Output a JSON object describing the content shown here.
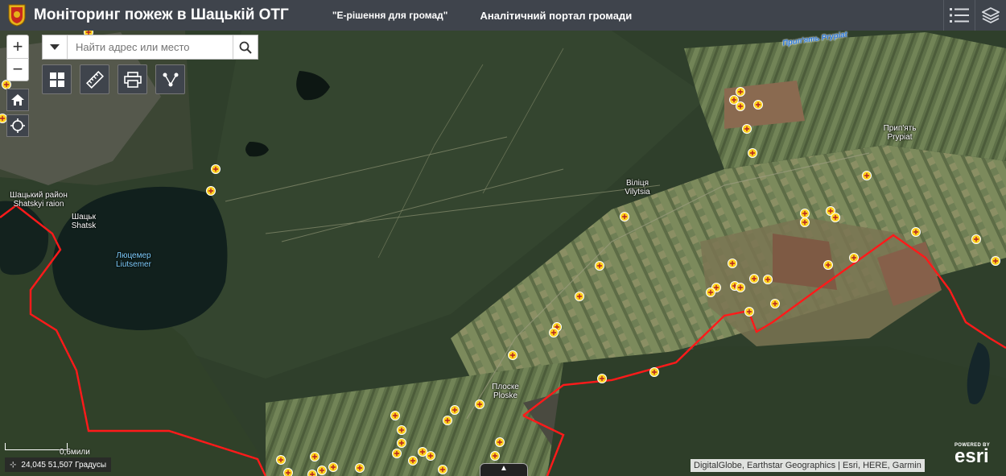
{
  "header": {
    "title": "Моніторинг пожеж в Шацькій ОТГ",
    "link1": "\"Е-рішення для громад\"",
    "link2": "Аналітичний портал громади"
  },
  "search": {
    "placeholder": "Найти адрес или место"
  },
  "labels": {
    "shatsk_raion": "Шацький район",
    "shatsk_raion_lat": "Shatskyi raion",
    "shatsk": "Шацьк",
    "shatsk_lat": "Shatsk",
    "liutsemer": "Люцемер",
    "liutsemer_lat": "Liutsemer",
    "vilytsia": "Віліця",
    "vilytsia_lat": "Vilytsia",
    "ploske": "Плоске",
    "ploske_lat": "Ploske",
    "prypiat": "Прип'ять",
    "prypiat_lat": "Prypiat",
    "river": "Прип'ять Prypiat"
  },
  "scale": {
    "text": "0,6мили"
  },
  "coords": {
    "text": "24,045 51,507 Градусы"
  },
  "attribution": "DigitalGlobe, Earthstar Geographics | Esri, HERE, Garmin",
  "esri": {
    "powered": "POWERED BY",
    "brand": "esri"
  },
  "colors": {
    "header_bg": "#3f444c",
    "boundary": "#ff1a1a",
    "fire_marker": "#ffd21f"
  },
  "icons": {
    "logo": "coat-of-arms-icon",
    "list": "list-icon",
    "layers": "layers-icon",
    "home": "home-icon",
    "locate": "locate-icon",
    "basemap": "basemap-gallery-icon",
    "measure": "ruler-icon",
    "print": "print-icon",
    "share": "share-icon"
  }
}
